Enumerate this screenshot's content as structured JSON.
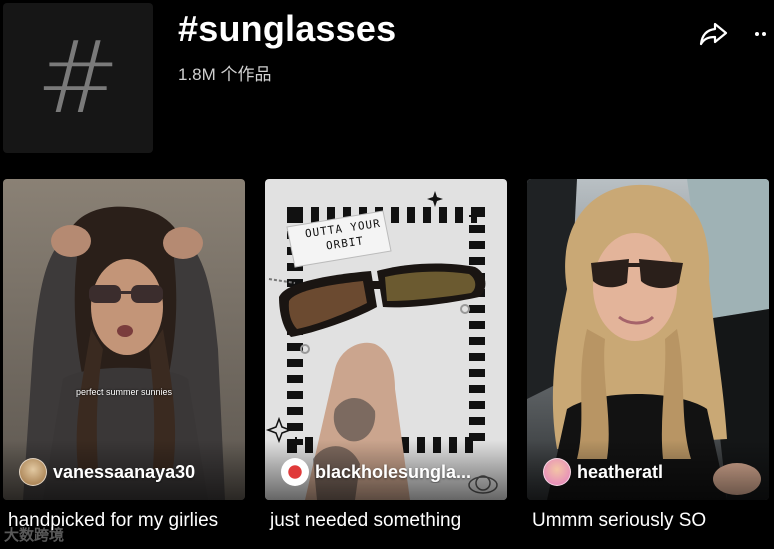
{
  "header": {
    "tag_symbol": "#",
    "title": "#sunglasses",
    "video_count": "1.8M 个作品",
    "share_icon": "share-arrow-icon",
    "more_icon": "more-dots-icon"
  },
  "videos": [
    {
      "author": "vanessaanaya30",
      "caption": "handpicked for my girlies",
      "overlay_text": "perfect summer sunnies",
      "avatar_color": "#d8b88a"
    },
    {
      "author": "blackholesungla...",
      "caption": "just needed something",
      "sticker_text": "OUTTA YOUR ORBIT",
      "avatar_color": "#e03a3a"
    },
    {
      "author": "heatheratl",
      "caption": "Ummm seriously SO",
      "avatar_color": "#e8a0c0"
    }
  ],
  "watermark": "大数跨境"
}
